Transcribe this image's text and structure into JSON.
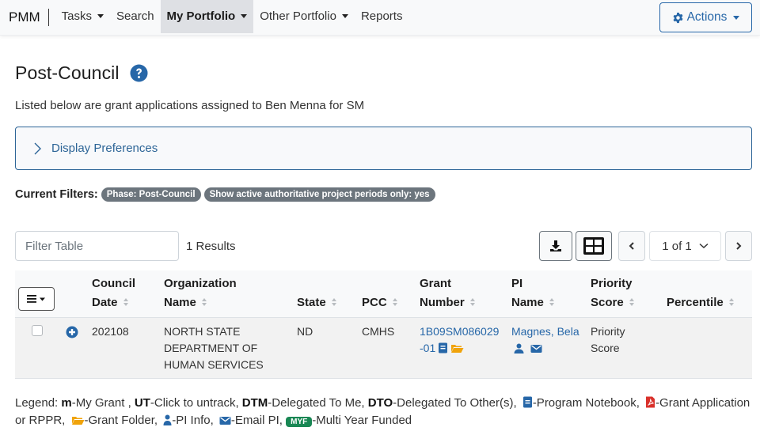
{
  "navbar": {
    "brand": "PMM",
    "items": [
      {
        "label": "Tasks",
        "dropdown": true
      },
      {
        "label": "Search",
        "dropdown": false
      },
      {
        "label": "My Portfolio",
        "dropdown": true,
        "active": true
      },
      {
        "label": "Other Portfolio",
        "dropdown": true
      },
      {
        "label": "Reports",
        "dropdown": false
      }
    ],
    "actions_label": "Actions"
  },
  "page": {
    "title": "Post-Council",
    "subtitle": "Listed below are grant applications assigned to Ben  Menna for SM",
    "display_preferences_label": "Display Preferences"
  },
  "filters": {
    "label": "Current Filters:",
    "badges": [
      "Phase: Post-Council",
      "Show active authoritative project periods only: yes"
    ]
  },
  "toolbar": {
    "filter_placeholder": "Filter Table",
    "filter_value": "",
    "results_text": "1 Results",
    "pagination": "1 of 1"
  },
  "table": {
    "columns": [
      {
        "line1": "Council",
        "line2": "Date"
      },
      {
        "line1": "Organization",
        "line2": "Name"
      },
      {
        "line1": "",
        "line2": "State"
      },
      {
        "line1": "",
        "line2": "PCC"
      },
      {
        "line1": "Grant",
        "line2": "Number"
      },
      {
        "line1": "PI",
        "line2": "Name"
      },
      {
        "line1": "Priority",
        "line2": "Score"
      },
      {
        "line1": "",
        "line2": "Percentile"
      }
    ],
    "rows": [
      {
        "council_date": "202108",
        "organization": "NORTH  STATE DEPARTMENT OF HUMAN SERVICES",
        "state": "ND",
        "pcc": "CMHS",
        "grant_number": "1B09SM086029-01",
        "pi_name": "Magnes, Bela",
        "priority_score": "Priority Score",
        "percentile": ""
      }
    ]
  },
  "legend": {
    "prefix": "Legend: ",
    "m_key": "m",
    "m_desc": "-My Grant , ",
    "ut_key": "UT",
    "ut_desc": "-Click to untrack, ",
    "dtm_key": "DTM",
    "dtm_desc": "-Delegated To Me, ",
    "dto_key": "DTO",
    "dto_desc": "-Delegated To Other(s), ",
    "notebook_desc": "-Program Notebook, ",
    "pdf_desc": "-Grant Application or RPPR, ",
    "folder_desc": "-Grant Folder, ",
    "pi_desc": "-PI Info, ",
    "email_desc": "-Email PI, ",
    "myf_badge": "MYF",
    "myf_desc": "-Multi Year Funded"
  },
  "colors": {
    "primary": "#2767a8",
    "badge_gray": "#6c757d",
    "folder_orange": "#f0a30a",
    "pdf_red": "#d9312b",
    "myf_green": "#198754"
  }
}
